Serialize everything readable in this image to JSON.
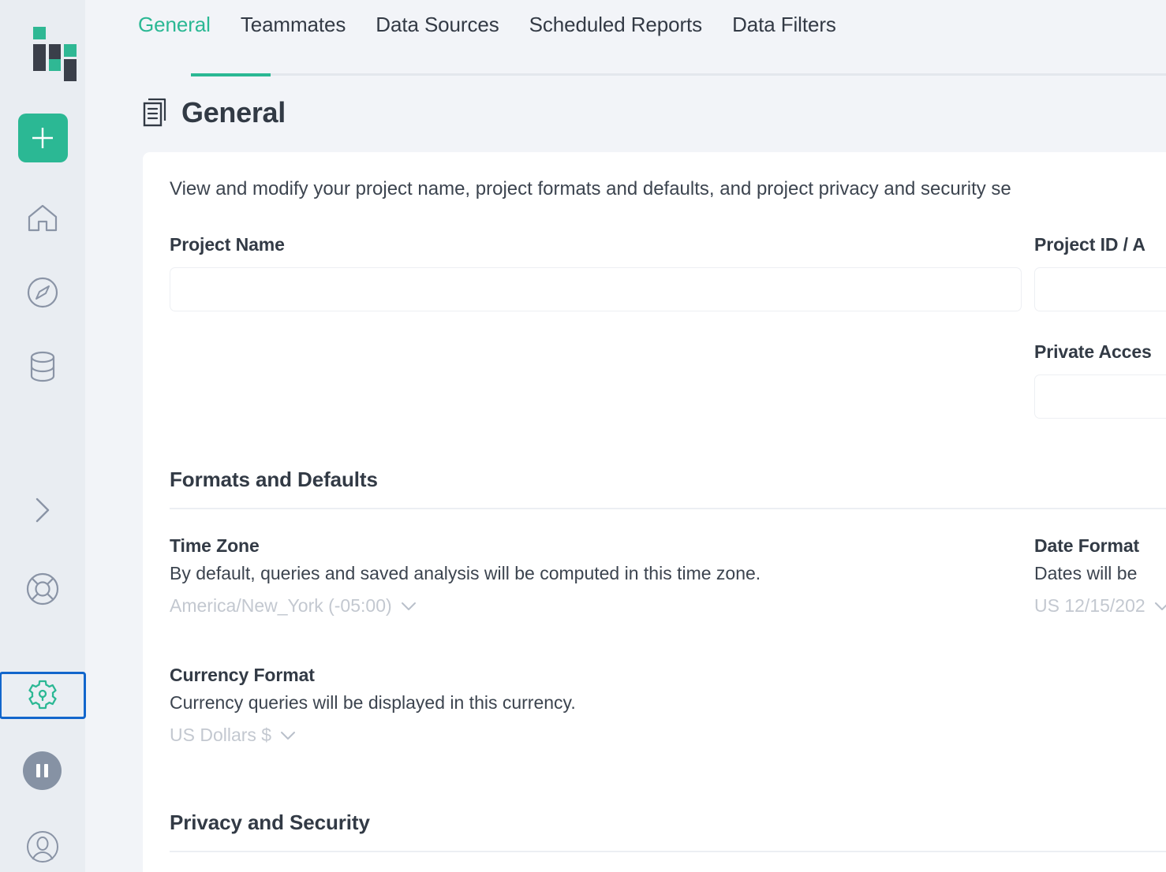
{
  "app": {
    "logo_name": "mode-analytics-logo",
    "accent_green": "#2bb894",
    "dark": "#3a3f4a",
    "focus_blue": "#1266cc",
    "sidebar_bg": "#e9edf2",
    "panel_bg": "#f2f4f8"
  },
  "sidebar": {
    "add_button_label": "+",
    "items": [
      {
        "name": "home-icon",
        "label": "Home"
      },
      {
        "name": "compass-icon",
        "label": "Explore"
      },
      {
        "name": "database-icon",
        "label": "Data"
      },
      {
        "name": "chevron-right-icon",
        "label": "Expand"
      },
      {
        "name": "lifebuoy-icon",
        "label": "Help"
      },
      {
        "name": "gear-icon",
        "label": "Settings"
      }
    ],
    "pause_label": "Pause",
    "avatar_label": "Account"
  },
  "tabs": [
    {
      "label": "General",
      "active": true
    },
    {
      "label": "Teammates",
      "active": false
    },
    {
      "label": "Data Sources",
      "active": false
    },
    {
      "label": "Scheduled Reports",
      "active": false
    },
    {
      "label": "Data Filters",
      "active": false
    }
  ],
  "page": {
    "title": "General",
    "icon": "documents-icon",
    "lede": "View and modify your project name, project formats and defaults, and project privacy and security se"
  },
  "fields": {
    "project_name": {
      "label": "Project Name",
      "value": "",
      "placeholder": ""
    },
    "project_id": {
      "label": "Project ID / A",
      "value": "",
      "placeholder": ""
    },
    "private_access": {
      "label": "Private Acces",
      "value": "",
      "placeholder": ""
    }
  },
  "formats": {
    "section_title": "Formats and Defaults",
    "time_zone": {
      "label": "Time Zone",
      "description": "By default, queries and saved analysis will be computed in this time zone.",
      "value": "America/New_York (-05:00)"
    },
    "date_format": {
      "label": "Date Format",
      "description": "Dates will be ",
      "value": "US 12/15/202"
    },
    "currency_format": {
      "label": "Currency Format",
      "description": "Currency queries will be displayed in this currency.",
      "value": "US Dollars $"
    }
  },
  "privacy": {
    "section_title": "Privacy and Security"
  }
}
